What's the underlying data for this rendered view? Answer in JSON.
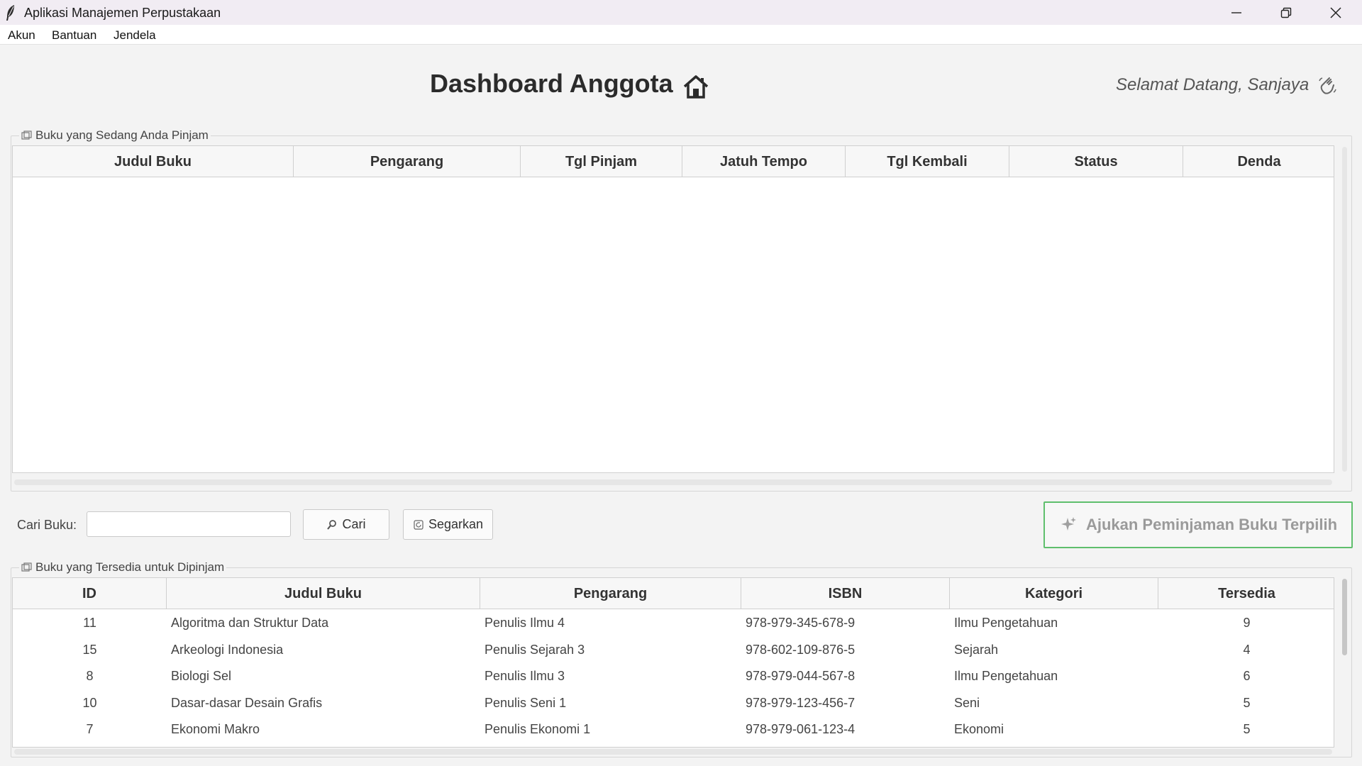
{
  "window": {
    "title": "Aplikasi Manajemen Perpustakaan"
  },
  "menu": [
    "Akun",
    "Bantuan",
    "Jendela"
  ],
  "header": {
    "title": "Dashboard Anggota",
    "welcome": "Selamat Datang, Sanjaya"
  },
  "borrowed": {
    "legend": "Buku yang Sedang Anda Pinjam",
    "columns": [
      "Judul Buku",
      "Pengarang",
      "Tgl Pinjam",
      "Jatuh Tempo",
      "Tgl Kembali",
      "Status",
      "Denda"
    ],
    "rows": []
  },
  "search": {
    "label": "Cari Buku:",
    "value": "",
    "search_button": "Cari",
    "refresh_button": "Segarkan",
    "submit_button": "Ajukan Peminjaman Buku Terpilih"
  },
  "available": {
    "legend": "Buku yang Tersedia untuk Dipinjam",
    "columns": [
      "ID",
      "Judul Buku",
      "Pengarang",
      "ISBN",
      "Kategori",
      "Tersedia"
    ],
    "rows": [
      [
        "11",
        "Algoritma dan Struktur Data",
        "Penulis Ilmu 4",
        "978-979-345-678-9",
        "Ilmu Pengetahuan",
        "9"
      ],
      [
        "15",
        "Arkeologi Indonesia",
        "Penulis Sejarah 3",
        "978-602-109-876-5",
        "Sejarah",
        "4"
      ],
      [
        "8",
        "Biologi Sel",
        "Penulis Ilmu 3",
        "978-979-044-567-8",
        "Ilmu Pengetahuan",
        "6"
      ],
      [
        "10",
        "Dasar-dasar Desain Grafis",
        "Penulis Seni 1",
        "978-979-123-456-7",
        "Seni",
        "5"
      ],
      [
        "7",
        "Ekonomi Makro",
        "Penulis Ekonomi 1",
        "978-979-061-123-4",
        "Ekonomi",
        "5"
      ]
    ]
  },
  "colors": {
    "accent_border": "#5fbf6d",
    "background": "#f3f3f3"
  }
}
